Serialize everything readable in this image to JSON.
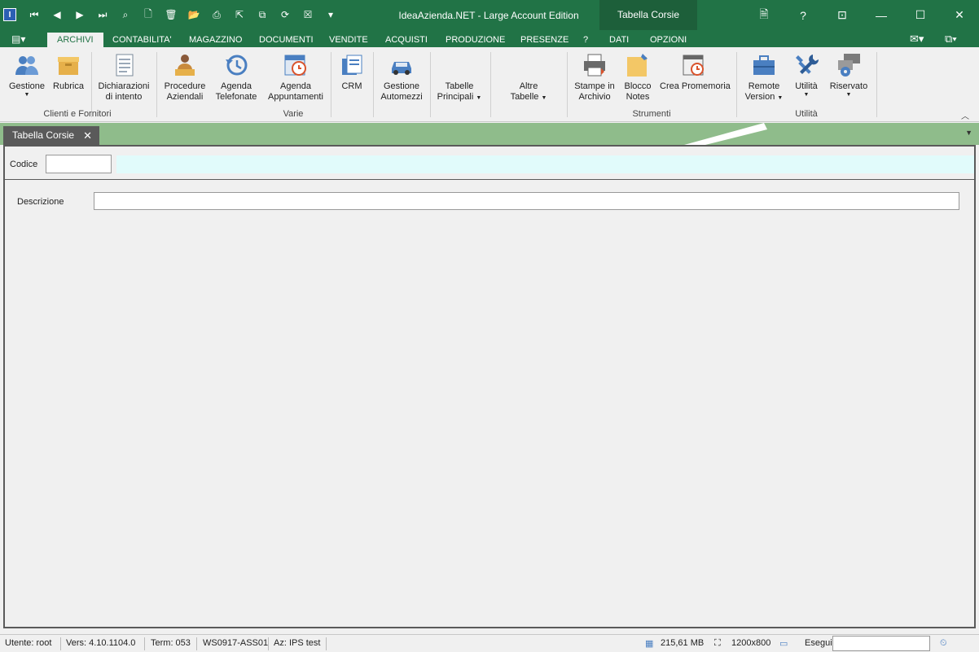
{
  "window": {
    "title": "IdeaAzienda.NET - Large Account Edition",
    "context_tab_title": "Tabella Corsie",
    "help": "?"
  },
  "menu_tabs": [
    {
      "label": "ARCHIVI",
      "active": true
    },
    {
      "label": "CONTABILITA'"
    },
    {
      "label": "MAGAZZINO"
    },
    {
      "label": "DOCUMENTI"
    },
    {
      "label": "VENDITE"
    },
    {
      "label": "ACQUISTI"
    },
    {
      "label": "PRODUZIONE"
    },
    {
      "label": "PRESENZE"
    },
    {
      "label": "?"
    },
    {
      "label": "DATI"
    },
    {
      "label": "OPZIONI"
    }
  ],
  "ribbon": {
    "buttons": [
      {
        "line1": "Gestione",
        "line2": "",
        "dropdown": true,
        "icon": "people-icon"
      },
      {
        "line1": "Rubrica",
        "line2": "",
        "icon": "box-icon"
      },
      {
        "line1": "Dichiarazioni",
        "line2": "di intento",
        "icon": "document-icon"
      },
      {
        "line1": "Procedure",
        "line2": "Aziendali",
        "icon": "person-desk-icon"
      },
      {
        "line1": "Agenda",
        "line2": "Telefonate",
        "icon": "history-icon"
      },
      {
        "line1": "Agenda",
        "line2": "Appuntamenti",
        "icon": "calendar-clock-icon"
      },
      {
        "line1": "CRM",
        "line2": "",
        "icon": "clipboard-icon"
      },
      {
        "line1": "Gestione",
        "line2": "Automezzi",
        "icon": "car-icon"
      },
      {
        "line1": "Tabelle",
        "line2": "Principali",
        "dropdown": true
      },
      {
        "line1": "Altre",
        "line2": "Tabelle",
        "dropdown": true
      },
      {
        "line1": "Stampe in",
        "line2": "Archivio",
        "icon": "printer-icon"
      },
      {
        "line1": "Blocco",
        "line2": "Notes",
        "icon": "sticky-note-icon"
      },
      {
        "line1": "Crea Promemoria",
        "line2": "",
        "icon": "calendar-alarm-icon"
      },
      {
        "line1": "Remote",
        "line2": "Version",
        "dropdown": true,
        "icon": "briefcase-icon"
      },
      {
        "line1": "Utilità",
        "line2": "",
        "dropdown": true,
        "icon": "tools-icon"
      },
      {
        "line1": "Riservato",
        "line2": "",
        "dropdown": true,
        "icon": "gear-windows-icon"
      }
    ],
    "groups": [
      "Clienti e Fornitori",
      "Varie",
      "Strumenti",
      "Utilità"
    ]
  },
  "doc_tab": {
    "label": "Tabella Corsie",
    "close": "✕"
  },
  "form": {
    "codice_label": "Codice",
    "codice_value": "",
    "descrizione_label": "Descrizione",
    "descrizione_value": ""
  },
  "status": {
    "utente": "Utente: root",
    "versione": "Vers: 4.10.1104.0",
    "term": "Term: 053",
    "workstation": "WS0917-ASS01",
    "azienda": "Az: IPS test",
    "memory": "215,61 MB",
    "resolution": "1200x800",
    "esegui_label": "Esegui",
    "esegui_value": ""
  },
  "colors": {
    "accent": "#217346",
    "context": "#1d5f3a",
    "band": "#8fbc8b",
    "cyan": "#e1fbfb"
  }
}
